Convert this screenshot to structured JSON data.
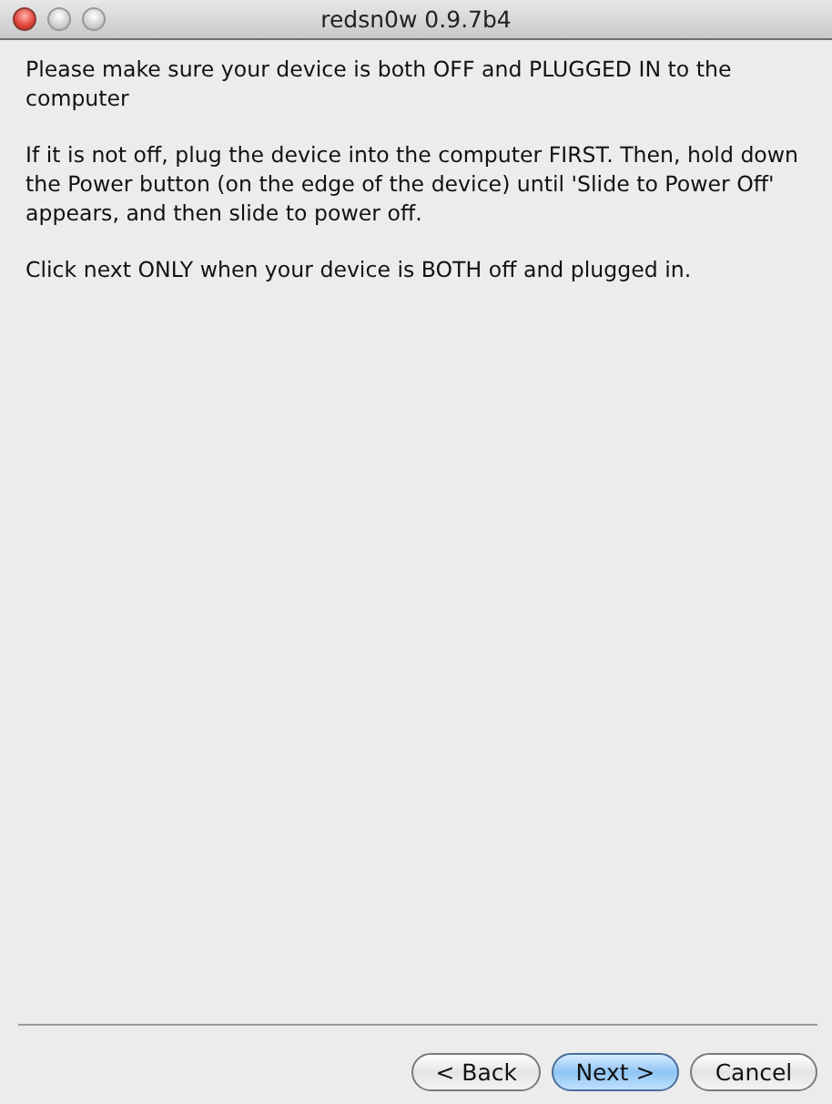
{
  "window": {
    "title": "redsn0w 0.9.7b4"
  },
  "paragraphs": [
    "Please make sure your device is both OFF and PLUGGED IN to the computer",
    "If it is not off, plug the device into the computer FIRST. Then, hold down the Power button (on the edge of the device) until 'Slide to Power Off' appears, and then slide to power off.",
    "Click next ONLY when your device is BOTH off and plugged in."
  ],
  "buttons": [
    {
      "label": "< Back",
      "default": false
    },
    {
      "label": "Next >",
      "default": true
    },
    {
      "label": "Cancel",
      "default": false
    }
  ]
}
